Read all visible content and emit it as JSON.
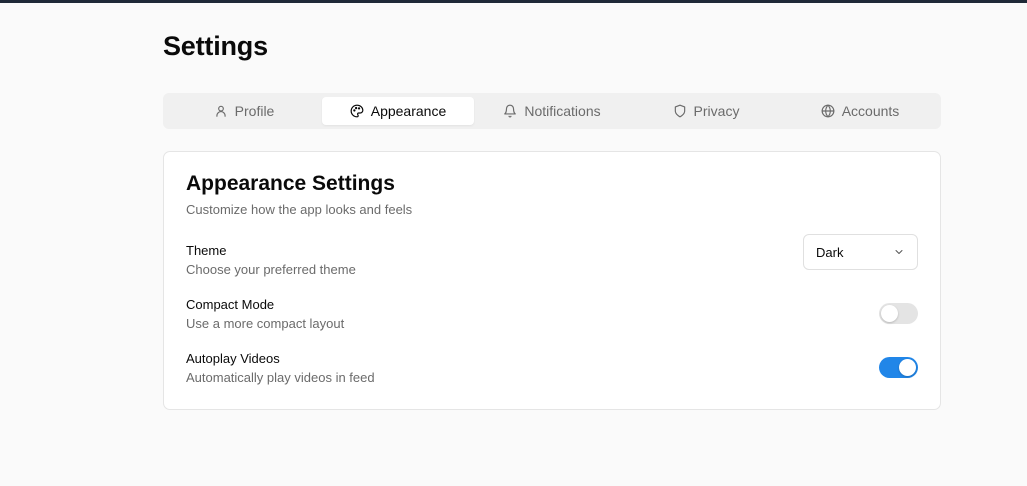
{
  "page": {
    "title": "Settings"
  },
  "tabs": [
    {
      "label": "Profile",
      "icon": "user-icon",
      "active": false
    },
    {
      "label": "Appearance",
      "icon": "palette-icon",
      "active": true
    },
    {
      "label": "Notifications",
      "icon": "bell-icon",
      "active": false
    },
    {
      "label": "Privacy",
      "icon": "shield-icon",
      "active": false
    },
    {
      "label": "Accounts",
      "icon": "globe-icon",
      "active": false
    }
  ],
  "card": {
    "title": "Appearance Settings",
    "subtitle": "Customize how the app looks and feels"
  },
  "settings": {
    "theme": {
      "label": "Theme",
      "description": "Choose your preferred theme",
      "value": "Dark"
    },
    "compact_mode": {
      "label": "Compact Mode",
      "description": "Use a more compact layout",
      "enabled": false
    },
    "autoplay": {
      "label": "Autoplay Videos",
      "description": "Automatically play videos in feed",
      "enabled": true
    }
  },
  "colors": {
    "accent": "#2186e8",
    "toggle_off": "#e4e4e4",
    "text_primary": "#0a0a0a",
    "text_muted": "#6b6b6b"
  }
}
